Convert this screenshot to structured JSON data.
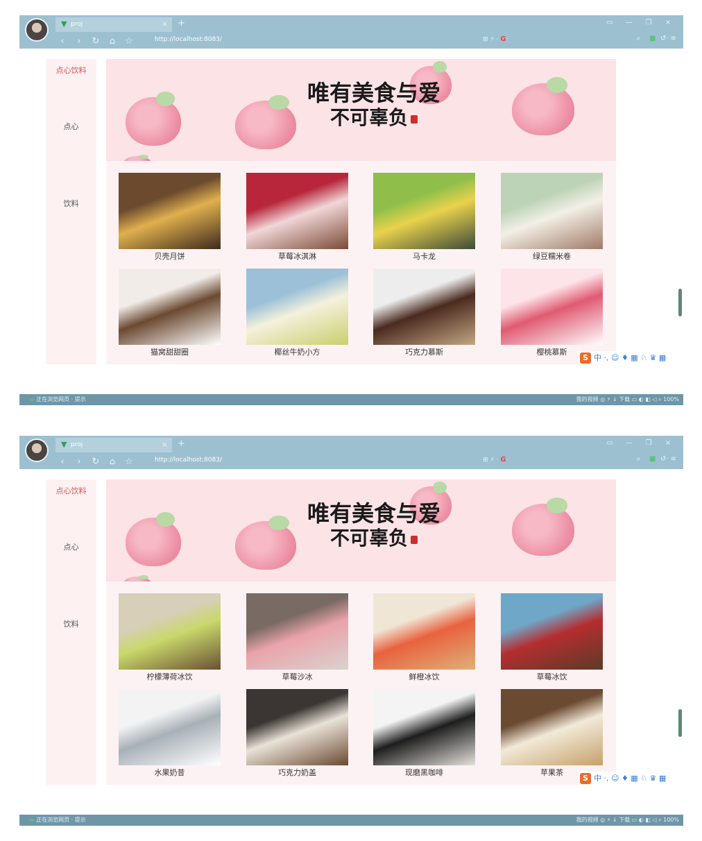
{
  "screens": [
    {
      "browser": {
        "tab_logo": "▼",
        "tab_title": "proj",
        "tab_close": "×",
        "new_tab": "+",
        "url": "http://localhost:8083/",
        "window_controls": [
          "▭",
          "—",
          "❐",
          "×"
        ]
      },
      "sidebar": {
        "items": [
          "点心饮料",
          "点心",
          "饮料"
        ],
        "active": "点心饮料"
      },
      "banner": {
        "line1": "唯有美食与爱",
        "line2": "不可辜负"
      },
      "products": [
        {
          "name": "贝壳月饼",
          "colors": [
            "#6b4a2e",
            "#e0b04e",
            "#3e2a1d"
          ]
        },
        {
          "name": "草莓冰淇淋",
          "colors": [
            "#b7263b",
            "#f1d6d8",
            "#7a4a35"
          ]
        },
        {
          "name": "马卡龙",
          "colors": [
            "#8fbf4a",
            "#e9d24c",
            "#3c4a3a"
          ]
        },
        {
          "name": "绿豆糯米卷",
          "colors": [
            "#bcd3b7",
            "#f3efe7",
            "#a07a66"
          ]
        },
        {
          "name": "猫窝甜甜圈",
          "colors": [
            "#f2ece8",
            "#6b4a32",
            "#ffffff"
          ]
        },
        {
          "name": "椰丝牛奶小方",
          "colors": [
            "#9bc0d8",
            "#f4f1dc",
            "#c9cf6d"
          ]
        },
        {
          "name": "巧克力慕斯",
          "colors": [
            "#ededed",
            "#4b2a1f",
            "#c4a784"
          ]
        },
        {
          "name": "樱桃慕斯",
          "colors": [
            "#fde4e8",
            "#e05a72",
            "#ffffff"
          ]
        }
      ],
      "statusbar": {
        "left": "正在浏览网页 · 提示",
        "right": "我的视频   ◎   ⚡   ↓   下载   ▭   ◐   ◧   ◁   ⌕   100%"
      }
    },
    {
      "browser": {
        "tab_logo": "▼",
        "tab_title": "proj",
        "tab_close": "×",
        "new_tab": "+",
        "url": "http://localhost:8083/",
        "window_controls": [
          "▭",
          "—",
          "❐",
          "×"
        ]
      },
      "sidebar": {
        "items": [
          "点心饮料",
          "点心",
          "饮料"
        ],
        "active": "点心饮料"
      },
      "banner": {
        "line1": "唯有美食与爱",
        "line2": "不可辜负"
      },
      "products": [
        {
          "name": "柠檬薄荷冰饮",
          "colors": [
            "#d7cfb8",
            "#c9d86a",
            "#6a5134"
          ]
        },
        {
          "name": "草莓沙冰",
          "colors": [
            "#7a6a64",
            "#eaa3aa",
            "#d9d3cf"
          ]
        },
        {
          "name": "鲜橙冰饮",
          "colors": [
            "#f0e6d6",
            "#e8623e",
            "#dfb079"
          ]
        },
        {
          "name": "草莓冰饮",
          "colors": [
            "#6fa7c8",
            "#b52d2f",
            "#5b3b28"
          ]
        },
        {
          "name": "水果奶昔",
          "colors": [
            "#f3f3f3",
            "#a8b0b7",
            "#ffffff"
          ]
        },
        {
          "name": "巧克力奶盖",
          "colors": [
            "#3b3633",
            "#e9e2d8",
            "#6b4a32"
          ]
        },
        {
          "name": "现磨黑咖啡",
          "colors": [
            "#f4f4f4",
            "#1e1e1e",
            "#e6e2dc"
          ]
        },
        {
          "name": "苹果茶",
          "colors": [
            "#6b4a32",
            "#f1ead8",
            "#c7a06a"
          ]
        }
      ],
      "statusbar": {
        "left": "正在浏览网页 · 提示",
        "right": "我的视频   ◎   ⚡   ↓   下载   ▭   ◐   ◧   ◁   ⌕   100%"
      }
    }
  ],
  "ime": {
    "logo": "S",
    "label": "中 ·, ☺ ♦ ▦ ♘ ♛ ▦"
  },
  "colors": {
    "accent": "#d9534f",
    "sidebar_bg": "#fdf1f2",
    "main_bg": "#fdf2f3",
    "banner_bg": "#fbe3e6",
    "browser_bar": "#9cc0d0"
  }
}
